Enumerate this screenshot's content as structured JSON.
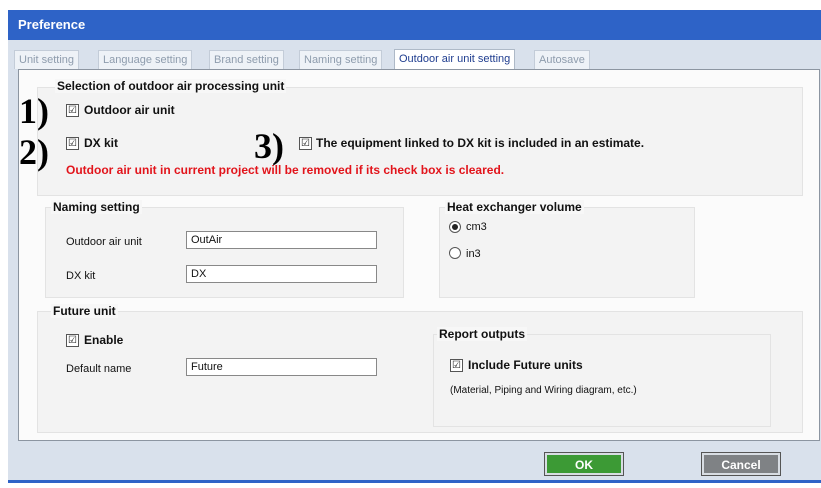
{
  "window": {
    "title": "Preference"
  },
  "tabs": [
    {
      "label": "Unit setting"
    },
    {
      "label": "Language setting"
    },
    {
      "label": "Brand setting"
    },
    {
      "label": "Naming setting"
    },
    {
      "label": "Outdoor air unit setting",
      "active": true
    },
    {
      "label": "Autosave"
    }
  ],
  "selection": {
    "title": "Selection of outdoor air processing unit",
    "outdoor_air_unit": {
      "label": "Outdoor air unit",
      "checked": true,
      "mark": "☑"
    },
    "dx_kit": {
      "label": "DX kit",
      "checked": true,
      "mark": "☑"
    },
    "linked": {
      "label": "The equipment linked to DX kit is included in an estimate.",
      "checked": true,
      "mark": "☑"
    },
    "warning": "Outdoor air unit in current project will be removed if its check box is cleared.",
    "annotations": [
      "1)",
      "2)",
      "3)"
    ]
  },
  "naming": {
    "title": "Naming setting",
    "outdoor_label": "Outdoor air unit",
    "outdoor_value": "OutAir",
    "dx_label": "DX kit",
    "dx_value": "DX"
  },
  "heat": {
    "title": "Heat exchanger volume",
    "opt1": "cm3",
    "opt2": "in3",
    "selected": "cm3"
  },
  "future": {
    "title": "Future unit",
    "enable_label": "Enable",
    "enable_mark": "☑",
    "default_label": "Default name",
    "default_value": "Future"
  },
  "report": {
    "title": "Report outputs",
    "include_label": "Include Future units",
    "include_mark": "☑",
    "note": "(Material, Piping and Wiring diagram, etc.)"
  },
  "buttons": {
    "ok": "OK",
    "cancel": "Cancel"
  },
  "colors": {
    "titlebar": "#2e63c7",
    "warning": "#e2141b",
    "ok": "#3c9a35",
    "cancel": "#7f8285"
  }
}
